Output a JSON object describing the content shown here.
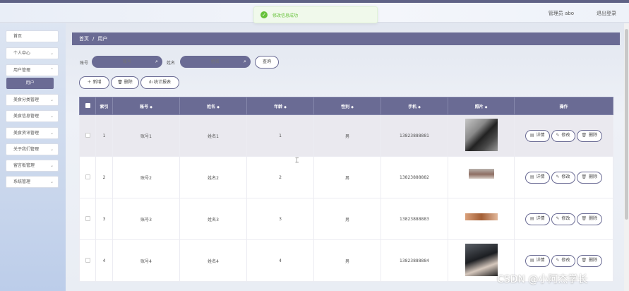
{
  "header": {
    "user_label": "管理员 abo",
    "logout_label": "退出登录"
  },
  "toast": {
    "icon": "check-circle-icon",
    "message": "修改信息成功",
    "color": "#67c23a"
  },
  "sidebar": {
    "items": [
      {
        "label": "首页",
        "has_children": false
      },
      {
        "label": "个人中心",
        "has_children": true
      },
      {
        "label": "用户管理",
        "has_children": true
      },
      {
        "label": "用户",
        "is_sub": true,
        "active": true
      },
      {
        "label": "美食分类管理",
        "has_children": true
      },
      {
        "label": "美食信息管理",
        "has_children": true
      },
      {
        "label": "美食资讯管理",
        "has_children": true
      },
      {
        "label": "关于我们管理",
        "has_children": true
      },
      {
        "label": "留言板管理",
        "has_children": true
      },
      {
        "label": "系统管理",
        "has_children": true
      }
    ]
  },
  "breadcrumb": {
    "home": "首页",
    "separator": "/",
    "current": "用户"
  },
  "search": {
    "account_label": "账号",
    "account_placeholder": "账号",
    "name_label": "姓名",
    "name_placeholder": "姓名",
    "query_button": "查询"
  },
  "toolbar": {
    "add_label": "新增",
    "delete_label": "删除",
    "stats_label": "统计报表"
  },
  "table": {
    "columns": [
      "索引",
      "账号",
      "姓名",
      "年龄",
      "性别",
      "手机",
      "照片",
      "操作"
    ],
    "sortable": [
      false,
      true,
      true,
      true,
      true,
      true,
      true,
      false
    ],
    "rows": [
      {
        "index": "1",
        "account": "账号1",
        "name": "姓名1",
        "age": "1",
        "gender": "男",
        "phone": "13823888881",
        "selected": true
      },
      {
        "index": "2",
        "account": "账号2",
        "name": "姓名2",
        "age": "2",
        "gender": "男",
        "phone": "13823888882"
      },
      {
        "index": "3",
        "account": "账号3",
        "name": "姓名3",
        "age": "3",
        "gender": "男",
        "phone": "13823888883"
      },
      {
        "index": "4",
        "account": "账号4",
        "name": "姓名4",
        "age": "4",
        "gender": "男",
        "phone": "13823888884"
      }
    ],
    "actions": {
      "detail": "详情",
      "edit": "修改",
      "delete": "删除"
    }
  },
  "watermark": "CSDN @小阿杰学长",
  "colors": {
    "accent": "#6a6b94",
    "success": "#67c23a"
  }
}
